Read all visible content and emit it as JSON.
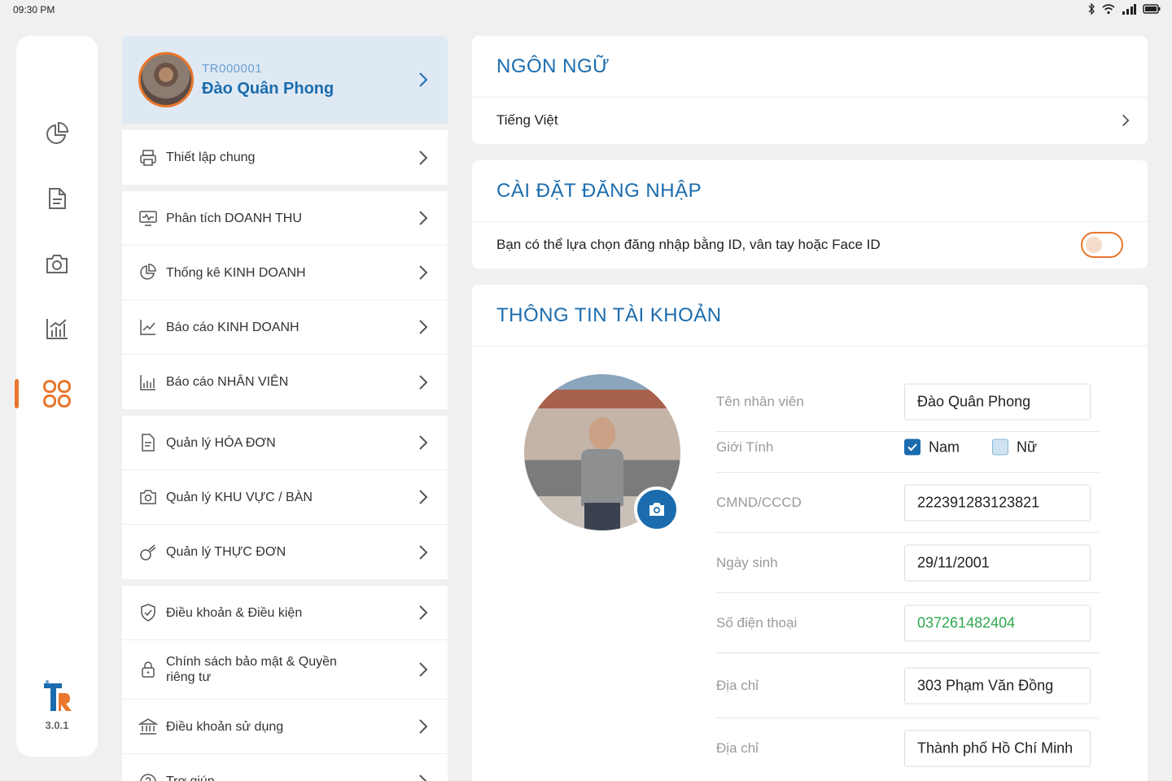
{
  "status_bar": {
    "time": "09:30 PM",
    "icons": [
      "bluetooth-icon",
      "wifi-icon",
      "signal-icon",
      "battery-icon"
    ]
  },
  "rail": {
    "items": [
      {
        "icon": "pie-chart-icon"
      },
      {
        "icon": "document-icon"
      },
      {
        "icon": "camera-icon"
      },
      {
        "icon": "bar-chart-icon"
      },
      {
        "icon": "grid-apps-icon",
        "active": true
      }
    ],
    "version": "3.0.1",
    "accent_color": "#e8762c"
  },
  "profile": {
    "code": "TR000001",
    "name": "Đào Quân Phong"
  },
  "menu": {
    "group1": [
      {
        "label": "Thiết lập chung",
        "icon": "printer-icon"
      }
    ],
    "group2": [
      {
        "label": "Phân tích DOANH THU",
        "icon": "monitor-pulse-icon"
      },
      {
        "label": "Thống kê KINH DOANH",
        "icon": "pie-chart-icon"
      },
      {
        "label": "Báo cáo KINH DOANH",
        "icon": "trend-chart-icon"
      },
      {
        "label": "Báo cáo NHÂN VIÊN",
        "icon": "bar-chart-icon"
      }
    ],
    "group3": [
      {
        "label": "Quản lý HÓA ĐƠN",
        "icon": "document-icon"
      },
      {
        "label": "Quản lý KHU VỰC / BÀN",
        "icon": "camera-icon"
      },
      {
        "label": "Quản lý THỰC ĐƠN",
        "icon": "food-icon"
      }
    ],
    "group4": [
      {
        "label": "Điều khoản & Điều kiện",
        "icon": "shield-check-icon"
      },
      {
        "label": "Chính sách bảo mật & Quyền riêng tư",
        "icon": "lock-icon"
      },
      {
        "label": "Điều khoản sử dụng",
        "icon": "bank-icon"
      },
      {
        "label": "Trợ giúp",
        "icon": "help-icon"
      }
    ]
  },
  "language": {
    "title": "NGÔN NGỮ",
    "value": "Tiếng Việt"
  },
  "login": {
    "title": "CÀI ĐẶT ĐĂNG NHẬP",
    "description": "Bạn có thể lựa chọn đăng nhập bằng ID, vân tay hoặc Face ID",
    "biometric_enabled": false
  },
  "account": {
    "title": "THÔNG TIN TÀI KHOẢN",
    "fields": {
      "name_label": "Tên nhân viên",
      "name_value": "Đào Quân Phong",
      "gender_label": "Giới Tính",
      "gender_male": "Nam",
      "gender_female": "Nữ",
      "gender_selected": "Nam",
      "id_label": "CMND/CCCD",
      "id_value": "222391283123821",
      "dob_label": "Ngày sinh",
      "dob_value": "29/11/2001",
      "phone_label": "Số điện thoại",
      "phone_value": "037261482404",
      "address_label": "Địa chỉ",
      "address_value": "303 Phạm Văn Đồng",
      "city_label": "Địa chỉ",
      "city_value": "Thành phố Hồ Chí Minh"
    }
  },
  "colors": {
    "primary": "#1b6cae",
    "accent": "#e8762c",
    "phone_green": "#2fa84f"
  }
}
